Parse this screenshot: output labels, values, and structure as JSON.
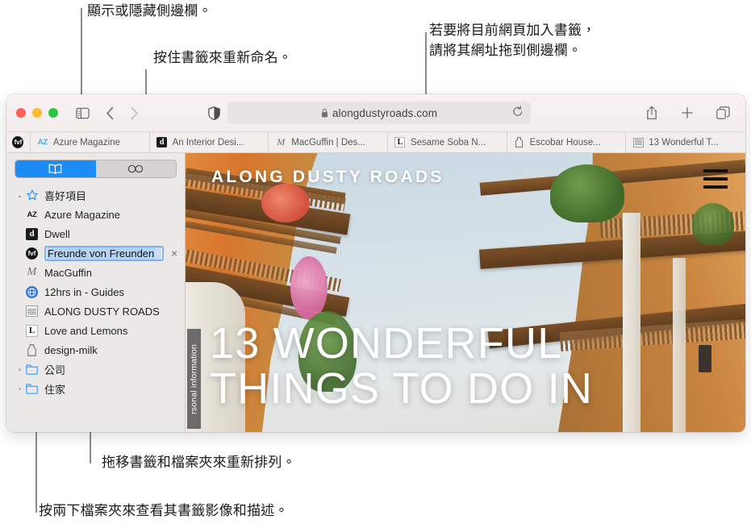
{
  "callouts": {
    "sidebar_toggle": "顯示或隱藏側邊欄。",
    "rename": "按住書籤來重新命名。",
    "add_bookmark": "若要將目前網頁加入書籤，\n請將其網址拖到側邊欄。",
    "drag_reorder": "拖移書籤和檔案夾來重新排列。",
    "double_click": "按兩下檔案夾來查看其書籤影像和描述。"
  },
  "toolbar": {
    "traffic_lights": [
      {
        "name": "close",
        "color": "#FF5F57"
      },
      {
        "name": "minimize",
        "color": "#FEBC2E"
      },
      {
        "name": "zoom",
        "color": "#28C840"
      }
    ],
    "sidebar_toggle_icon": "sidebar-icon",
    "back_icon": "‹",
    "forward_icon": "›",
    "shield_icon": "privacy-shield-icon",
    "reader_icon": "reader-view-icon",
    "lock_icon": "lock-icon",
    "url": "alongdustyroads.com",
    "reload_icon": "↻",
    "share_icon": "share-icon",
    "new_tab_icon": "+",
    "tab_overview_icon": "tab-overview-icon"
  },
  "tabs": [
    {
      "favicon": "fvf",
      "label": ""
    },
    {
      "favicon": "az",
      "label": "Azure Magazine"
    },
    {
      "favicon": "dwell",
      "label": "An Interior Desi..."
    },
    {
      "favicon": "macguffin",
      "label": "MacGuffin | Des..."
    },
    {
      "favicon": "love-lemons",
      "label": "Sesame Soba N..."
    },
    {
      "favicon": "design-milk",
      "label": "Escobar House..."
    },
    {
      "favicon": "along-dusty-roads",
      "label": "13 Wonderful T..."
    }
  ],
  "sidebar": {
    "segmented": [
      {
        "name": "bookmarks-tab",
        "icon": "book-icon",
        "selected": true
      },
      {
        "name": "reading-list-tab",
        "icon": "glasses-icon",
        "selected": false
      }
    ],
    "group": {
      "label": "喜好項目",
      "disclosure": "⌄",
      "icon": "star-icon"
    },
    "items": [
      {
        "label": "Azure Magazine",
        "favicon": "az",
        "type": "bookmark"
      },
      {
        "label": "Dwell",
        "favicon": "dwell",
        "type": "bookmark"
      },
      {
        "label": "Freunde von Freunden",
        "favicon": "fvf",
        "type": "bookmark",
        "editing": true
      },
      {
        "label": "MacGuffin",
        "favicon": "macguffin",
        "type": "bookmark"
      },
      {
        "label": "12hrs in - Guides",
        "favicon": "globe",
        "type": "bookmark"
      },
      {
        "label": "ALONG DUSTY ROADS",
        "favicon": "along-dusty-roads",
        "type": "bookmark"
      },
      {
        "label": "Love and Lemons",
        "favicon": "love-lemons",
        "type": "bookmark"
      },
      {
        "label": "design-milk",
        "favicon": "design-milk",
        "type": "bookmark"
      }
    ],
    "folders": [
      {
        "label": "公司",
        "disclosure": "›",
        "icon": "folder-icon"
      },
      {
        "label": "住家",
        "disclosure": "›",
        "icon": "folder-icon"
      }
    ],
    "editing_clear_icon": "×"
  },
  "page": {
    "brand": "ALONG DUSTY ROADS",
    "title": "13 WONDERFUL\nTHINGS TO DO IN",
    "menu_icon": "hamburger-menu-icon",
    "privacy_strip": "rsonal information"
  },
  "colors": {
    "accent": "#1e8cf5",
    "sidebar_bg": "#ebe9e8",
    "toolbar_bg": "#f4efee",
    "selection": "#b6d3f4",
    "leader_line": "#8a8a8a"
  }
}
